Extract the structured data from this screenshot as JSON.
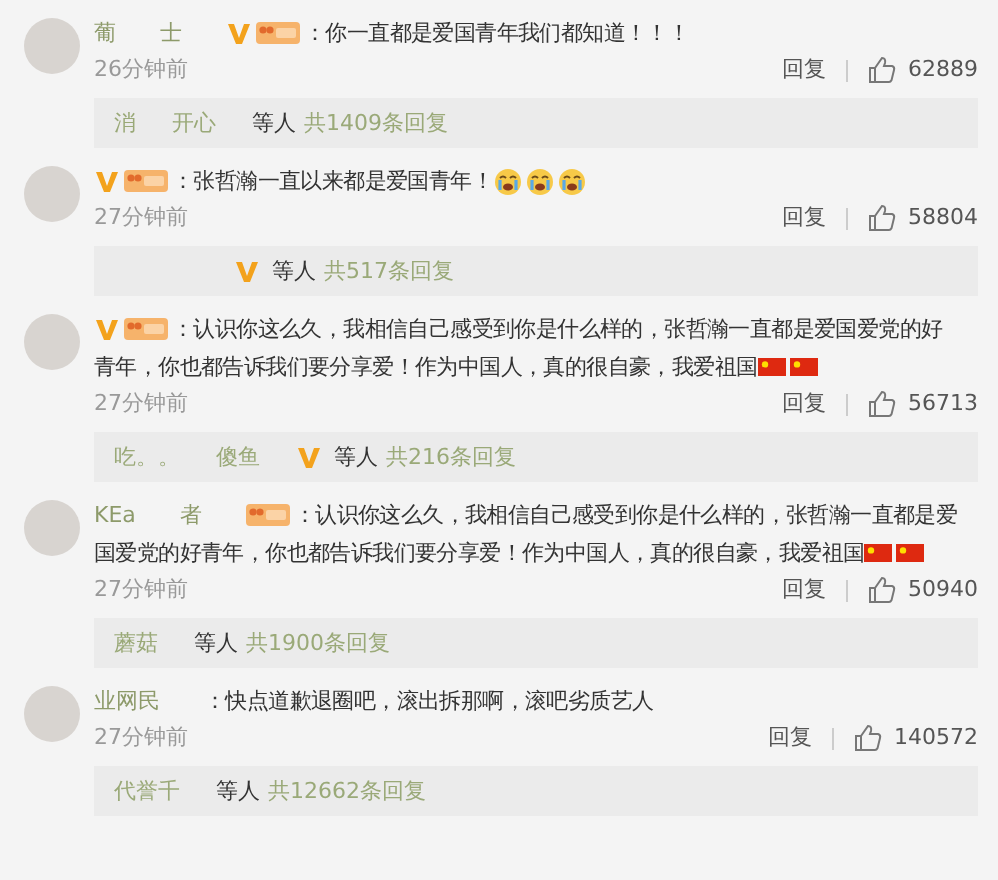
{
  "comments": [
    {
      "user": [
        "葡",
        "士"
      ],
      "verified": true,
      "fan_badge": true,
      "text_lines": [
        "：你一直都是爱国青年我们都知道！！！"
      ],
      "time": "26分钟前",
      "reply_label": "回复",
      "likes": "62889",
      "replies": {
        "users": [
          "消",
          "开心"
        ],
        "verified": false,
        "others": "等人",
        "total": "共1409条回复"
      }
    },
    {
      "verified": true,
      "fan_badge": true,
      "text_lines": [
        "：张哲瀚一直以来都是爱国青年！"
      ],
      "emoji": [
        {
          "kind": "crying"
        },
        {
          "kind": "crying"
        },
        {
          "kind": "crying"
        }
      ],
      "time": "27分钟前",
      "reply_label": "回复",
      "likes": "58804",
      "replies": {
        "verified": true,
        "others": "等人",
        "total": "共517条回复"
      }
    },
    {
      "verified": true,
      "fan_badge": true,
      "text_lines": [
        "：认识你这么久，我相信自己感受到你是什么样的，张哲瀚一直都是爱国爱党的好",
        "青年，你也都告诉我们要分享爱！作为中国人，真的很自豪，我爱祖国"
      ],
      "emoji": [
        {
          "kind": "flag"
        },
        {
          "kind": "flag"
        }
      ],
      "time": "27分钟前",
      "reply_label": "回复",
      "likes": "56713",
      "replies": {
        "users": [
          "吃。。",
          "傻鱼"
        ],
        "verified": true,
        "others": "等人",
        "total": "共216条回复"
      }
    },
    {
      "user": [
        "KEa",
        "者"
      ],
      "verified": false,
      "fan_badge": true,
      "text_lines": [
        "：认识你这么久，我相信自己感受到你是什么样的，张哲瀚一直都是爱",
        "国爱党的好青年，你也都告诉我们要分享爱！作为中国人，真的很自豪，我爱祖国"
      ],
      "emoji": [
        {
          "kind": "flag"
        },
        {
          "kind": "flag"
        }
      ],
      "time": "27分钟前",
      "reply_label": "回复",
      "likes": "50940",
      "replies": {
        "users": [
          "蘑菇"
        ],
        "verified": false,
        "others": "等人",
        "total": "共1900条回复"
      }
    },
    {
      "user": [
        "业网民"
      ],
      "verified": false,
      "fan_badge": false,
      "text_lines": [
        "：快点道歉退圈吧，滚出拆那啊，滚吧劣质艺人"
      ],
      "time": "27分钟前",
      "reply_label": "回复",
      "likes": "140572",
      "replies": {
        "users": [
          "代誉千"
        ],
        "verified": false,
        "others": "等人",
        "total": "共12662条回复"
      }
    }
  ]
}
